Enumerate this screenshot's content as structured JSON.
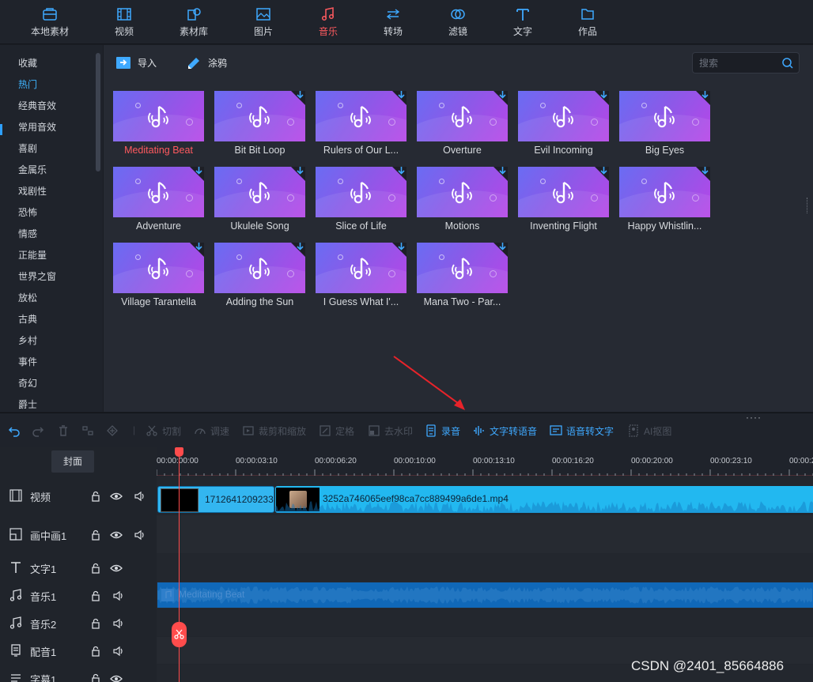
{
  "tabs": [
    {
      "label": "本地素材",
      "icon": "local-material-icon"
    },
    {
      "label": "视频",
      "icon": "film-icon"
    },
    {
      "label": "素材库",
      "icon": "library-icon"
    },
    {
      "label": "图片",
      "icon": "image-icon"
    },
    {
      "label": "音乐",
      "icon": "music-icon",
      "active": true
    },
    {
      "label": "转场",
      "icon": "transition-icon"
    },
    {
      "label": "滤镜",
      "icon": "filter-icon"
    },
    {
      "label": "文字",
      "icon": "text-icon"
    },
    {
      "label": "作品",
      "icon": "folder-icon"
    }
  ],
  "categories": [
    "收藏",
    "热门",
    "经典音效",
    "常用音效",
    "喜剧",
    "金属乐",
    "戏剧性",
    "恐怖",
    "情感",
    "正能量",
    "世界之窗",
    "放松",
    "古典",
    "乡村",
    "事件",
    "奇幻",
    "爵士"
  ],
  "active_category": "热门",
  "library": {
    "import_label": "导入",
    "graffiti_label": "涂鸦",
    "search_placeholder": "搜索",
    "items": [
      "Meditating Beat",
      "Bit Bit Loop",
      "Rulers of Our L...",
      "Overture",
      "Evil Incoming",
      "Big Eyes",
      "Adventure",
      "Ukulele Song",
      "Slice of Life",
      "Motions",
      "Inventing Flight",
      "Happy Whistlin...",
      "Village Tarantella",
      "Adding the Sun",
      "I Guess What I'...",
      "Mana Two - Par..."
    ],
    "selected_item": "Meditating Beat"
  },
  "toolbar": {
    "undo": "undo-icon",
    "redo": "redo-icon",
    "delete": "trash-icon",
    "split_layout": "layout-icon",
    "marker": "marker-icon",
    "cut": "切割",
    "speed": "调速",
    "crop_zoom": "裁剪和缩放",
    "freeze": "定格",
    "remove_watermark": "去水印",
    "record": "录音",
    "tts": "文字转语音",
    "stt": "语音转文字",
    "ai_cutout": "AI抠图",
    "more": "····"
  },
  "timeline": {
    "cover_label": "封面",
    "ruler": [
      "00:00:00:00",
      "00:00:03:10",
      "00:00:06:20",
      "00:00:10:00",
      "00:00:13:10",
      "00:00:16:20",
      "00:00:20:00",
      "00:00:23:10",
      "00:00:2"
    ],
    "tracks": [
      {
        "name": "视频",
        "icon": "film-icon",
        "controls": [
          "lock-icon",
          "eye-icon",
          "speaker-icon"
        ]
      },
      {
        "name": "画中画1",
        "icon": "pip-icon",
        "controls": [
          "lock-icon",
          "eye-icon",
          "speaker-icon"
        ]
      },
      {
        "name": "文字1",
        "icon": "text-icon",
        "controls": [
          "lock-icon",
          "eye-icon"
        ]
      },
      {
        "name": "音乐1",
        "icon": "music-icon",
        "controls": [
          "lock-icon",
          "speaker-icon"
        ]
      },
      {
        "name": "音乐2",
        "icon": "music-icon",
        "controls": [
          "lock-icon",
          "speaker-icon"
        ]
      },
      {
        "name": "配音1",
        "icon": "mic-icon",
        "controls": [
          "lock-icon",
          "speaker-icon"
        ]
      },
      {
        "name": "字幕1",
        "icon": "subtitle-icon",
        "controls": [
          "lock-icon",
          "eye-icon"
        ]
      }
    ],
    "clips": {
      "video1": "1712641209233",
      "video2": "3252a746065eef98ca7cc889499a6de1.mp4",
      "music1": "Meditating Beat"
    }
  },
  "watermark": "CSDN @2401_85664886"
}
